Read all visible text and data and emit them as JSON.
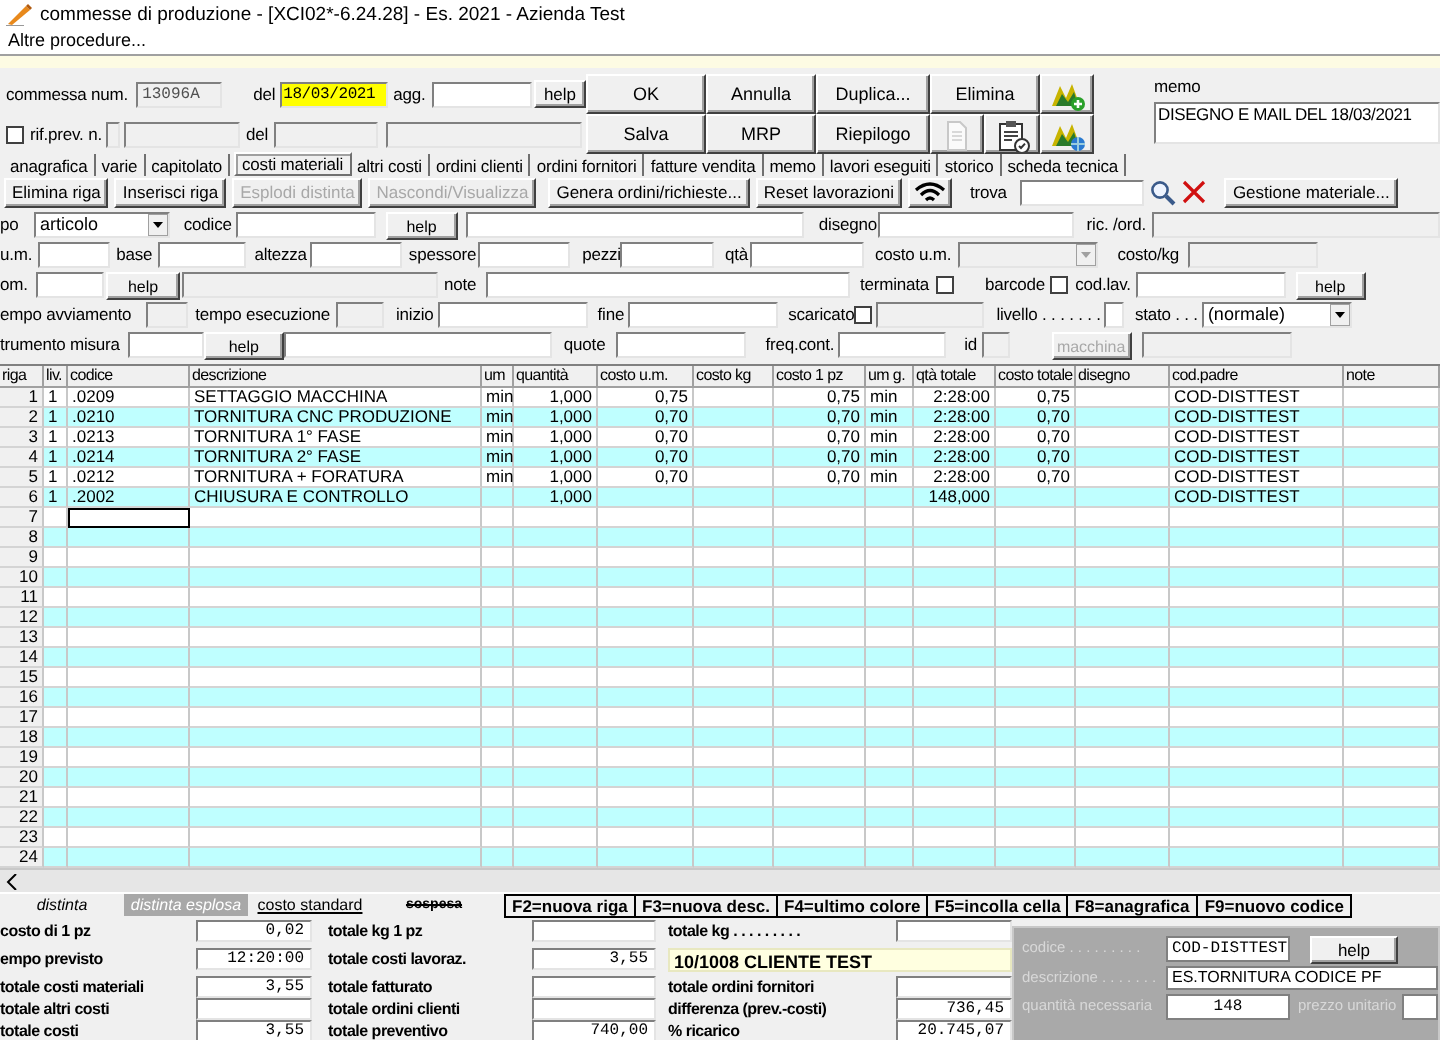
{
  "window": {
    "title": "commesse di produzione - [XCI02*-6.24.28] - Es. 2021 - Azienda Test"
  },
  "menu": [
    {
      "label": "Altre procedure..."
    }
  ],
  "header": {
    "rows": [
      {
        "items": [
          {
            "kind": "label",
            "text": "commessa num."
          },
          {
            "kind": "field",
            "value": "13096A",
            "disabled": true,
            "highlighted": false
          },
          {
            "kind": "label",
            "text": "del"
          },
          {
            "kind": "field",
            "value": "18/03/2021",
            "disabled": false,
            "highlighted": true
          },
          {
            "kind": "label",
            "text": "agg."
          },
          {
            "kind": "field",
            "disabled": false,
            "highlighted": false
          },
          {
            "kind": "button",
            "label": "help",
            "disabled": false
          }
        ]
      },
      {
        "items": [
          {
            "kind": "check",
            "checked": false
          },
          {
            "kind": "label",
            "text": "rif.prev. n."
          },
          {
            "kind": "field",
            "disabled": true,
            "highlighted": false
          },
          {
            "kind": "field",
            "disabled": true,
            "highlighted": false
          },
          {
            "kind": "label",
            "text": "del"
          },
          {
            "kind": "field",
            "disabled": true,
            "highlighted": false
          },
          {
            "kind": "field",
            "disabled": true,
            "highlighted": false
          }
        ]
      }
    ],
    "buttons": [
      {
        "label": "OK",
        "disabled": false
      },
      {
        "label": "Annulla",
        "disabled": false
      },
      {
        "label": "Duplica...",
        "disabled": false
      },
      {
        "label": "Elimina",
        "disabled": false
      },
      {
        "label": "Salva",
        "disabled": false
      },
      {
        "label": "MRP",
        "disabled": false
      },
      {
        "label": "Riepilogo",
        "disabled": false
      }
    ],
    "icon_buttons": [
      {
        "disabled": false
      },
      {
        "disabled": true
      },
      {
        "disabled": false
      },
      {
        "disabled": false
      }
    ],
    "memo": {
      "label": "memo",
      "value": "DISEGNO E MAIL DEL 18/03/2021"
    }
  },
  "tabs": [
    {
      "label": "anagrafica",
      "selected": false
    },
    {
      "label": "varie",
      "selected": false
    },
    {
      "label": "capitolato",
      "selected": false
    },
    {
      "label": "costi materiali",
      "selected": true
    },
    {
      "label": "altri costi",
      "selected": false
    },
    {
      "label": "ordini clienti",
      "selected": false
    },
    {
      "label": "ordini fornitori",
      "selected": false
    },
    {
      "label": "fatture vendita",
      "selected": false
    },
    {
      "label": "memo",
      "selected": false
    },
    {
      "label": "lavori eseguiti",
      "selected": false
    },
    {
      "label": "storico",
      "selected": false
    },
    {
      "label": "scheda tecnica",
      "selected": false
    }
  ],
  "toolbar": {
    "buttons": [
      {
        "label": "Elimina riga",
        "disabled": false
      },
      {
        "label": "Inserisci riga",
        "disabled": false
      },
      {
        "label": "Esplodi distinta",
        "disabled": true
      },
      {
        "label": "Nascondi/Visualizza",
        "disabled": true
      },
      {
        "label": "Genera ordini/richieste...",
        "disabled": false
      },
      {
        "label": "Reset lavorazioni",
        "disabled": false
      }
    ],
    "find_label": "trova",
    "material_button": "Gestione materiale..."
  },
  "form": {
    "rows": [
      {
        "items": [
          {
            "kind": "label",
            "text": "po"
          },
          {
            "kind": "select",
            "value": "articolo",
            "disabled": false
          },
          {
            "kind": "label",
            "text": "codice"
          },
          {
            "kind": "field",
            "disabled": false
          },
          {
            "kind": "button",
            "label": "help",
            "disabled": false
          },
          {
            "kind": "field",
            "disabled": false
          },
          {
            "kind": "label",
            "text": "disegno"
          },
          {
            "kind": "field",
            "disabled": false
          },
          {
            "kind": "label",
            "text": "ric. /ord."
          },
          {
            "kind": "field",
            "disabled": true
          }
        ]
      },
      {
        "items": [
          {
            "kind": "label",
            "text": "u.m."
          },
          {
            "kind": "field",
            "disabled": false
          },
          {
            "kind": "label",
            "text": "base"
          },
          {
            "kind": "field",
            "disabled": false
          },
          {
            "kind": "label",
            "text": "altezza"
          },
          {
            "kind": "field",
            "disabled": false
          },
          {
            "kind": "label",
            "text": "spessore"
          },
          {
            "kind": "field",
            "disabled": false
          },
          {
            "kind": "label",
            "text": "pezzi"
          },
          {
            "kind": "field",
            "disabled": false
          },
          {
            "kind": "label",
            "text": "qtà"
          },
          {
            "kind": "field",
            "disabled": false
          },
          {
            "kind": "label",
            "text": "costo u.m."
          },
          {
            "kind": "select",
            "disabled": true
          },
          {
            "kind": "label",
            "text": "costo/kg"
          },
          {
            "kind": "field",
            "disabled": true
          }
        ]
      },
      {
        "items": [
          {
            "kind": "label",
            "text": "om."
          },
          {
            "kind": "field",
            "disabled": false
          },
          {
            "kind": "button",
            "label": "help",
            "disabled": false
          },
          {
            "kind": "field",
            "disabled": true
          },
          {
            "kind": "label",
            "text": "note"
          },
          {
            "kind": "field",
            "disabled": false
          },
          {
            "kind": "label",
            "text": "terminata"
          },
          {
            "kind": "check",
            "checked": false
          },
          {
            "kind": "label",
            "text": "barcode"
          },
          {
            "kind": "check",
            "checked": false
          },
          {
            "kind": "label",
            "text": "cod.lav."
          },
          {
            "kind": "field",
            "disabled": false
          },
          {
            "kind": "button",
            "label": "help",
            "disabled": false
          }
        ]
      },
      {
        "items": [
          {
            "kind": "label",
            "text": "empo avviamento"
          },
          {
            "kind": "field",
            "disabled": true
          },
          {
            "kind": "label",
            "text": "tempo esecuzione"
          },
          {
            "kind": "field",
            "disabled": true
          },
          {
            "kind": "label",
            "text": "inizio"
          },
          {
            "kind": "field",
            "disabled": false
          },
          {
            "kind": "label",
            "text": "fine"
          },
          {
            "kind": "field",
            "disabled": false
          },
          {
            "kind": "label",
            "text": "scaricato"
          },
          {
            "kind": "check",
            "checked": false
          },
          {
            "kind": "field",
            "disabled": true
          },
          {
            "kind": "label",
            "text": "livello . . . . . . ."
          },
          {
            "kind": "field",
            "disabled": false
          },
          {
            "kind": "label",
            "text": "stato . . ."
          },
          {
            "kind": "select",
            "value": "(normale)",
            "disabled": false
          }
        ]
      },
      {
        "items": [
          {
            "kind": "label",
            "text": "trumento misura"
          },
          {
            "kind": "field",
            "disabled": false
          },
          {
            "kind": "button",
            "label": "help",
            "disabled": false
          },
          {
            "kind": "field",
            "disabled": false
          },
          {
            "kind": "label",
            "text": "quote"
          },
          {
            "kind": "field",
            "disabled": false
          },
          {
            "kind": "label",
            "text": "freq.cont."
          },
          {
            "kind": "field",
            "disabled": false
          },
          {
            "kind": "label",
            "text": "id"
          },
          {
            "kind": "field",
            "disabled": true
          },
          {
            "kind": "button",
            "label": "macchina",
            "disabled": true
          },
          {
            "kind": "field",
            "disabled": true
          }
        ]
      }
    ]
  },
  "table": {
    "columns": [
      "riga",
      "liv.",
      "codice",
      "descrizione",
      "um",
      "quantità",
      "costo u.m.",
      "costo kg",
      "costo 1 pz",
      "um g.",
      "qtà totale",
      "costo totale",
      "disegno",
      "cod.padre",
      "note"
    ],
    "rows": [
      {
        "focused": false,
        "cells": [
          "1",
          "1",
          ".0209",
          "SETTAGGIO MACCHINA",
          "min",
          "1,000",
          "0,75",
          null,
          "0,75",
          "min",
          "2:28:00",
          "0,75",
          null,
          "COD-DISTTEST",
          null
        ]
      },
      {
        "focused": false,
        "cells": [
          "2",
          "1",
          ".0210",
          "TORNITURA CNC PRODUZIONE",
          "min",
          "1,000",
          "0,70",
          null,
          "0,70",
          "min",
          "2:28:00",
          "0,70",
          null,
          "COD-DISTTEST",
          null
        ]
      },
      {
        "focused": false,
        "cells": [
          "3",
          "1",
          ".0213",
          "TORNITURA 1° FASE",
          "min",
          "1,000",
          "0,70",
          null,
          "0,70",
          "min",
          "2:28:00",
          "0,70",
          null,
          "COD-DISTTEST",
          null
        ]
      },
      {
        "focused": false,
        "cells": [
          "4",
          "1",
          ".0214",
          "TORNITURA 2° FASE",
          "min",
          "1,000",
          "0,70",
          null,
          "0,70",
          "min",
          "2:28:00",
          "0,70",
          null,
          "COD-DISTTEST",
          null
        ]
      },
      {
        "focused": false,
        "cells": [
          "5",
          "1",
          ".0212",
          "TORNITURA + FORATURA",
          "min",
          "1,000",
          "0,70",
          null,
          "0,70",
          "min",
          "2:28:00",
          "0,70",
          null,
          "COD-DISTTEST",
          null
        ]
      },
      {
        "focused": false,
        "cells": [
          "6",
          "1",
          ".2002",
          "CHIUSURA E CONTROLLO",
          null,
          "1,000",
          null,
          null,
          null,
          null,
          "148,000",
          null,
          null,
          "COD-DISTTEST",
          null
        ]
      },
      {
        "focused": true,
        "cells": [
          "7",
          null,
          null,
          null,
          null,
          null,
          null,
          null,
          null,
          null,
          null,
          null,
          null,
          null,
          null
        ]
      },
      {
        "focused": false,
        "cells": [
          "8",
          null,
          null,
          null,
          null,
          null,
          null,
          null,
          null,
          null,
          null,
          null,
          null,
          null,
          null
        ]
      },
      {
        "focused": false,
        "cells": [
          "9",
          null,
          null,
          null,
          null,
          null,
          null,
          null,
          null,
          null,
          null,
          null,
          null,
          null,
          null
        ]
      },
      {
        "focused": false,
        "cells": [
          "10",
          null,
          null,
          null,
          null,
          null,
          null,
          null,
          null,
          null,
          null,
          null,
          null,
          null,
          null
        ]
      },
      {
        "focused": false,
        "cells": [
          "11",
          null,
          null,
          null,
          null,
          null,
          null,
          null,
          null,
          null,
          null,
          null,
          null,
          null,
          null
        ]
      },
      {
        "focused": false,
        "cells": [
          "12",
          null,
          null,
          null,
          null,
          null,
          null,
          null,
          null,
          null,
          null,
          null,
          null,
          null,
          null
        ]
      },
      {
        "focused": false,
        "cells": [
          "13",
          null,
          null,
          null,
          null,
          null,
          null,
          null,
          null,
          null,
          null,
          null,
          null,
          null,
          null
        ]
      },
      {
        "focused": false,
        "cells": [
          "14",
          null,
          null,
          null,
          null,
          null,
          null,
          null,
          null,
          null,
          null,
          null,
          null,
          null,
          null
        ]
      },
      {
        "focused": false,
        "cells": [
          "15",
          null,
          null,
          null,
          null,
          null,
          null,
          null,
          null,
          null,
          null,
          null,
          null,
          null,
          null
        ]
      },
      {
        "focused": false,
        "cells": [
          "16",
          null,
          null,
          null,
          null,
          null,
          null,
          null,
          null,
          null,
          null,
          null,
          null,
          null,
          null
        ]
      },
      {
        "focused": false,
        "cells": [
          "17",
          null,
          null,
          null,
          null,
          null,
          null,
          null,
          null,
          null,
          null,
          null,
          null,
          null,
          null
        ]
      },
      {
        "focused": false,
        "cells": [
          "18",
          null,
          null,
          null,
          null,
          null,
          null,
          null,
          null,
          null,
          null,
          null,
          null,
          null,
          null
        ]
      },
      {
        "focused": false,
        "cells": [
          "19",
          null,
          null,
          null,
          null,
          null,
          null,
          null,
          null,
          null,
          null,
          null,
          null,
          null,
          null
        ]
      },
      {
        "focused": false,
        "cells": [
          "20",
          null,
          null,
          null,
          null,
          null,
          null,
          null,
          null,
          null,
          null,
          null,
          null,
          null,
          null
        ]
      },
      {
        "focused": false,
        "cells": [
          "21",
          null,
          null,
          null,
          null,
          null,
          null,
          null,
          null,
          null,
          null,
          null,
          null,
          null,
          null
        ]
      },
      {
        "focused": false,
        "cells": [
          "22",
          null,
          null,
          null,
          null,
          null,
          null,
          null,
          null,
          null,
          null,
          null,
          null,
          null,
          null
        ]
      },
      {
        "focused": false,
        "cells": [
          "23",
          null,
          null,
          null,
          null,
          null,
          null,
          null,
          null,
          null,
          null,
          null,
          null,
          null,
          null
        ]
      },
      {
        "focused": false,
        "cells": [
          "24",
          null,
          null,
          null,
          null,
          null,
          null,
          null,
          null,
          null,
          null,
          null,
          null,
          null,
          null
        ]
      }
    ]
  },
  "bottom_tabs": [
    {
      "label": "distinta",
      "kind": "italic",
      "selected": false
    },
    {
      "label": "distinta esplosa",
      "kind": "italic",
      "selected": true
    },
    {
      "label": "costo standard",
      "kind": "underline",
      "selected": false
    },
    {
      "label": "sospesa",
      "kind": "strike",
      "selected": false
    }
  ],
  "function_keys": [
    "F2=nuova riga",
    "F3=nuova desc.",
    "F4=ultimo colore",
    "F5=incolla cella",
    "F8=anagrafica",
    "F9=nuovo codice"
  ],
  "summary": {
    "columns": [
      [
        {
          "kind": "field",
          "label": "costo di 1 pz",
          "value": "0,02"
        },
        {
          "kind": "field",
          "label": "empo previsto",
          "value": "12:20:00"
        },
        {
          "kind": "field",
          "label": "totale costi materiali",
          "value": "3,55"
        },
        {
          "kind": "field",
          "label": "totale altri costi"
        },
        {
          "kind": "field",
          "label": "totale costi",
          "value": "3,55"
        }
      ],
      [
        {
          "kind": "field",
          "label": "totale kg 1 pz"
        },
        {
          "kind": "field",
          "label": "totale costi lavoraz.",
          "value": "3,55"
        },
        {
          "kind": "field",
          "label": "totale fatturato"
        },
        {
          "kind": "field",
          "label": "totale ordini clienti"
        },
        {
          "kind": "field",
          "label": "totale preventivo",
          "value": "740,00"
        }
      ],
      [
        {
          "kind": "field",
          "label": "totale kg . . . . . . . . ."
        },
        {
          "kind": "banner",
          "value": "10/1008 CLIENTE TEST"
        },
        {
          "kind": "field",
          "label": "totale ordini fornitori"
        },
        {
          "kind": "field",
          "label": "differenza (prev.-costi)",
          "value": "736,45"
        },
        {
          "kind": "field",
          "label": "% ricarico",
          "value": "20.745,07"
        }
      ]
    ]
  },
  "article_panel": {
    "codice_label": "codice . . . . . . . . .",
    "codice": "COD-DISTTEST",
    "help": "help",
    "descrizione_label": "descrizione . . . . . . .",
    "descrizione": "ES.TORNITURA CODICE PF",
    "quantita_label": "quantità necessaria",
    "quantita": "148",
    "prezzo_label": "prezzo unitario"
  }
}
